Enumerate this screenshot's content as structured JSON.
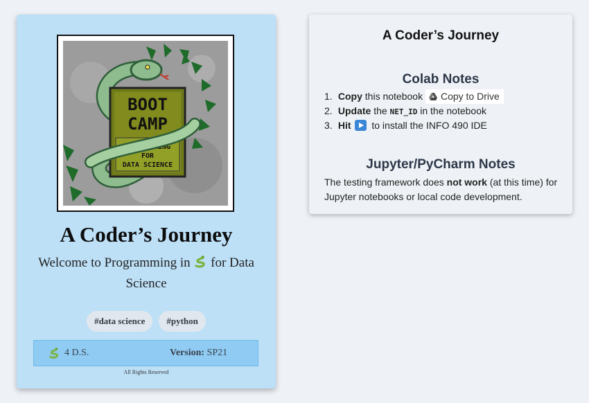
{
  "card": {
    "cover_image": {
      "art_lines": [
        "BOOT",
        "CAMP"
      ],
      "plate_lines": [
        "PROGRAMMING",
        "FOR",
        "DATA SCIENCE"
      ],
      "colors": {
        "snake": "#8fbc8f",
        "snake_dark": "#2f5f3a",
        "plate": "#6f7a1a",
        "leaves": "#1e6b2a",
        "background": "#9a9a9a"
      }
    },
    "title": "A Coder’s Journey",
    "subtitle_before": "Welcome to Programming in",
    "subtitle_after": "for Data Science",
    "tags": [
      "#data science",
      "#python"
    ],
    "footer": {
      "left_text": "4 D.S.",
      "version_label": "Version:",
      "version_value": "SP21"
    },
    "rights": "All Rights Reserved"
  },
  "panel": {
    "title": "A Coder’s Journey",
    "colab": {
      "heading": "Colab Notes",
      "steps": [
        {
          "num": "1.",
          "bold": "Copy",
          "text": "this notebook",
          "button": "Copy to Drive"
        },
        {
          "num": "2.",
          "bold": "Update",
          "text_before": "the",
          "code": "NET_ID",
          "text_after": "in the notebook"
        },
        {
          "num": "3.",
          "bold": "Hit",
          "text_after": "to install the INFO 490 IDE"
        }
      ]
    },
    "jupyter": {
      "heading": "Jupyter/PyCharm Notes",
      "text_before": "The testing framework does",
      "bold": "not work",
      "text_after": "(at this time) for Jupyter notebooks or local code development."
    }
  },
  "colors": {
    "page_bg": "#eef2f6",
    "card_bg": "#bde0f7",
    "footer_bg": "#8fcbf2",
    "tag_bg": "#e1e7ee",
    "play_button": "#3b87d6"
  }
}
